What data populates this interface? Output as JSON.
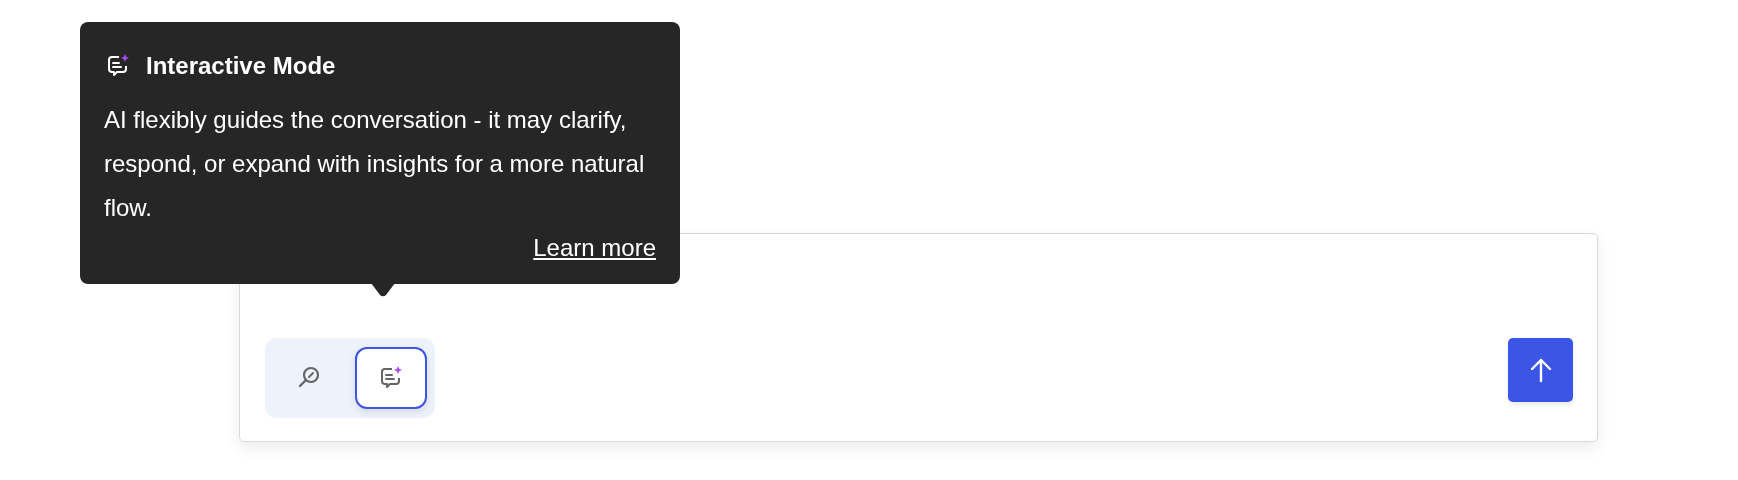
{
  "tooltip": {
    "kind": "interactive",
    "title": "Interactive Mode",
    "description": "AI flexibly guides the conversation - it may clarify, respond, or expand with insights for a more natural flow.",
    "link": "Learn more"
  },
  "composer": {
    "modes": [
      {
        "kind": "search",
        "selected": false
      },
      {
        "kind": "interactive",
        "selected": true
      }
    ]
  }
}
